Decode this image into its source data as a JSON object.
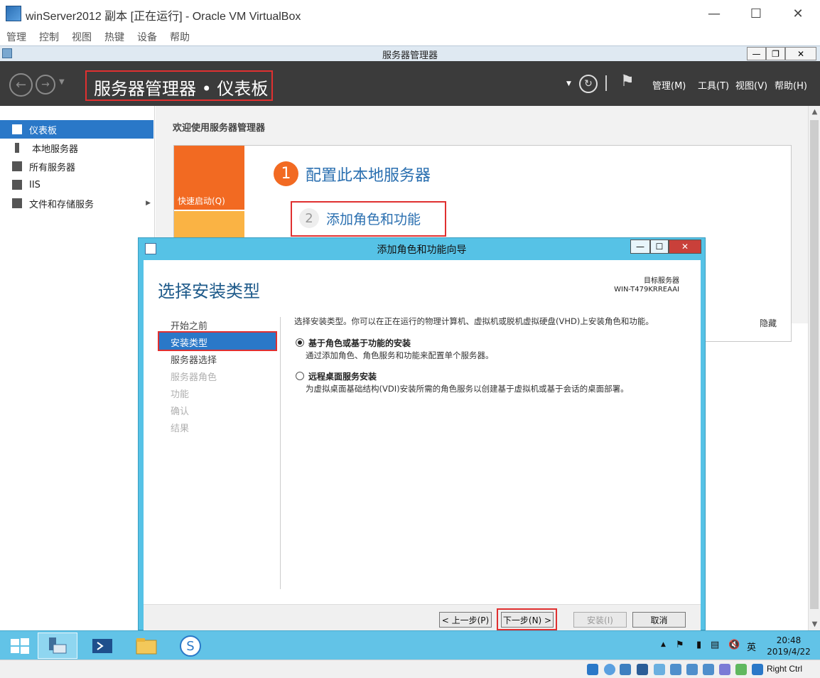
{
  "vbox": {
    "title": "winServer2012 副本 [正在运行] - Oracle VM VirtualBox",
    "menu": [
      "管理",
      "控制",
      "视图",
      "热键",
      "设备",
      "帮助"
    ],
    "host_key": "Right Ctrl"
  },
  "server_manager": {
    "window_title": "服务器管理器",
    "breadcrumb": "服务器管理器 • 仪表板",
    "header_menu": [
      "管理(M)",
      "工具(T)",
      "视图(V)",
      "帮助(H)"
    ],
    "sidebar": [
      {
        "label": "仪表板",
        "selected": true
      },
      {
        "label": "本地服务器",
        "selected": false
      },
      {
        "label": "所有服务器",
        "selected": false
      },
      {
        "label": "IIS",
        "selected": false
      },
      {
        "label": "文件和存储服务",
        "selected": false
      }
    ],
    "welcome": "欢迎使用服务器管理器",
    "quick_start": "快速启动(Q)",
    "step1_num": "1",
    "step1": "配置此本地服务器",
    "step2_num": "2",
    "step2": "添加角色和功能",
    "hide": "隐藏"
  },
  "wizard": {
    "title": "添加角色和功能向导",
    "heading": "选择安装类型",
    "target_label": "目标服务器",
    "target_server": "WIN-T479KRREAAI",
    "nav": [
      {
        "label": "开始之前",
        "state": "normal"
      },
      {
        "label": "安装类型",
        "state": "selected"
      },
      {
        "label": "服务器选择",
        "state": "normal"
      },
      {
        "label": "服务器角色",
        "state": "disabled"
      },
      {
        "label": "功能",
        "state": "disabled"
      },
      {
        "label": "确认",
        "state": "disabled"
      },
      {
        "label": "结果",
        "state": "disabled"
      }
    ],
    "description": "选择安装类型。你可以在正在运行的物理计算机、虚拟机或脱机虚拟硬盘(VHD)上安装角色和功能。",
    "options": [
      {
        "title": "基于角色或基于功能的安装",
        "desc": "通过添加角色、角色服务和功能来配置单个服务器。",
        "checked": true
      },
      {
        "title": "远程桌面服务安装",
        "desc": "为虚拟桌面基础结构(VDI)安装所需的角色服务以创建基于虚拟机或基于会话的桌面部署。",
        "checked": false
      }
    ],
    "buttons": {
      "prev": "< 上一步(P)",
      "next": "下一步(N) >",
      "install": "安装(I)",
      "cancel": "取消"
    }
  },
  "taskbar": {
    "time": "20:48",
    "date": "2019/4/22",
    "ime": "英"
  },
  "colors": {
    "accent_blue": "#2a78c8",
    "orange": "#f26a22",
    "wizard_frame": "#56c2e6",
    "highlight_red": "#e03030"
  }
}
